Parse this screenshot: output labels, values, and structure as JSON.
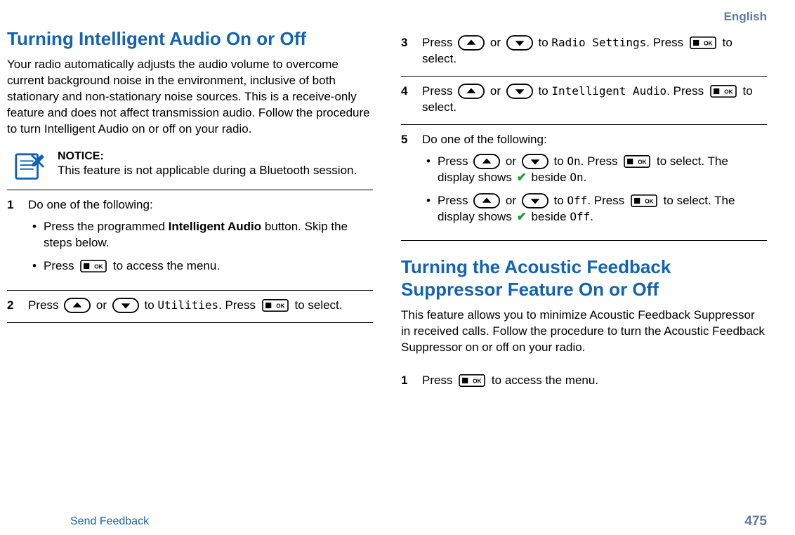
{
  "header": {
    "language": "English"
  },
  "section1": {
    "title": "Turning Intelligent Audio On or Off",
    "intro": "Your radio automatically adjusts the audio volume to overcome current background noise in the environment, inclusive of both stationary and non-stationary noise sources. This is a receive-only feature and does not affect transmission audio. Follow the procedure to turn Intelligent Audio on or off on your radio.",
    "notice": {
      "label": "NOTICE:",
      "text": "This feature is not applicable during a Bluetooth session."
    },
    "steps": {
      "s1": {
        "num": "1",
        "lead": "Do one of the following:",
        "b1a": "Press the programmed ",
        "b1bold": "Intelligent Audio",
        "b1b": " button. Skip the steps below.",
        "b2a": "Press ",
        "b2b": " to access the menu."
      },
      "s2": {
        "num": "2",
        "a": "Press ",
        "b": " or ",
        "c": " to ",
        "menu": "Utilities",
        "d": ". Press ",
        "e": " to select."
      },
      "s3": {
        "num": "3",
        "a": "Press ",
        "b": " or ",
        "c": " to ",
        "menu": "Radio Settings",
        "d": ". Press ",
        "e": " to select."
      },
      "s4": {
        "num": "4",
        "a": "Press ",
        "b": " or ",
        "c": " to ",
        "menu": "Intelligent Audio",
        "d": ". Press ",
        "e": " to select."
      },
      "s5": {
        "num": "5",
        "lead": "Do one of the following:",
        "on_a": "Press ",
        "on_b": " or ",
        "on_c": " to ",
        "on_menu": "On",
        "on_d": ". Press ",
        "on_e": " to select. The display shows ",
        "on_f": " beside ",
        "on_g": ".",
        "off_a": "Press ",
        "off_b": " or ",
        "off_c": " to ",
        "off_menu": "Off",
        "off_d": ". Press ",
        "off_e": " to select. The display shows ",
        "off_f": " beside ",
        "off_g": "."
      }
    }
  },
  "section2": {
    "title": "Turning the Acoustic Feedback Suppressor Feature On or Off",
    "intro": "This feature allows you to minimize Acoustic Feedback Suppressor in received calls. Follow the procedure to turn the Acoustic Feedback Suppressor on or off on your radio.",
    "steps": {
      "s1": {
        "num": "1",
        "a": "Press ",
        "b": " to access the menu."
      }
    }
  },
  "footer": {
    "feedback": "Send Feedback",
    "page": "475"
  }
}
